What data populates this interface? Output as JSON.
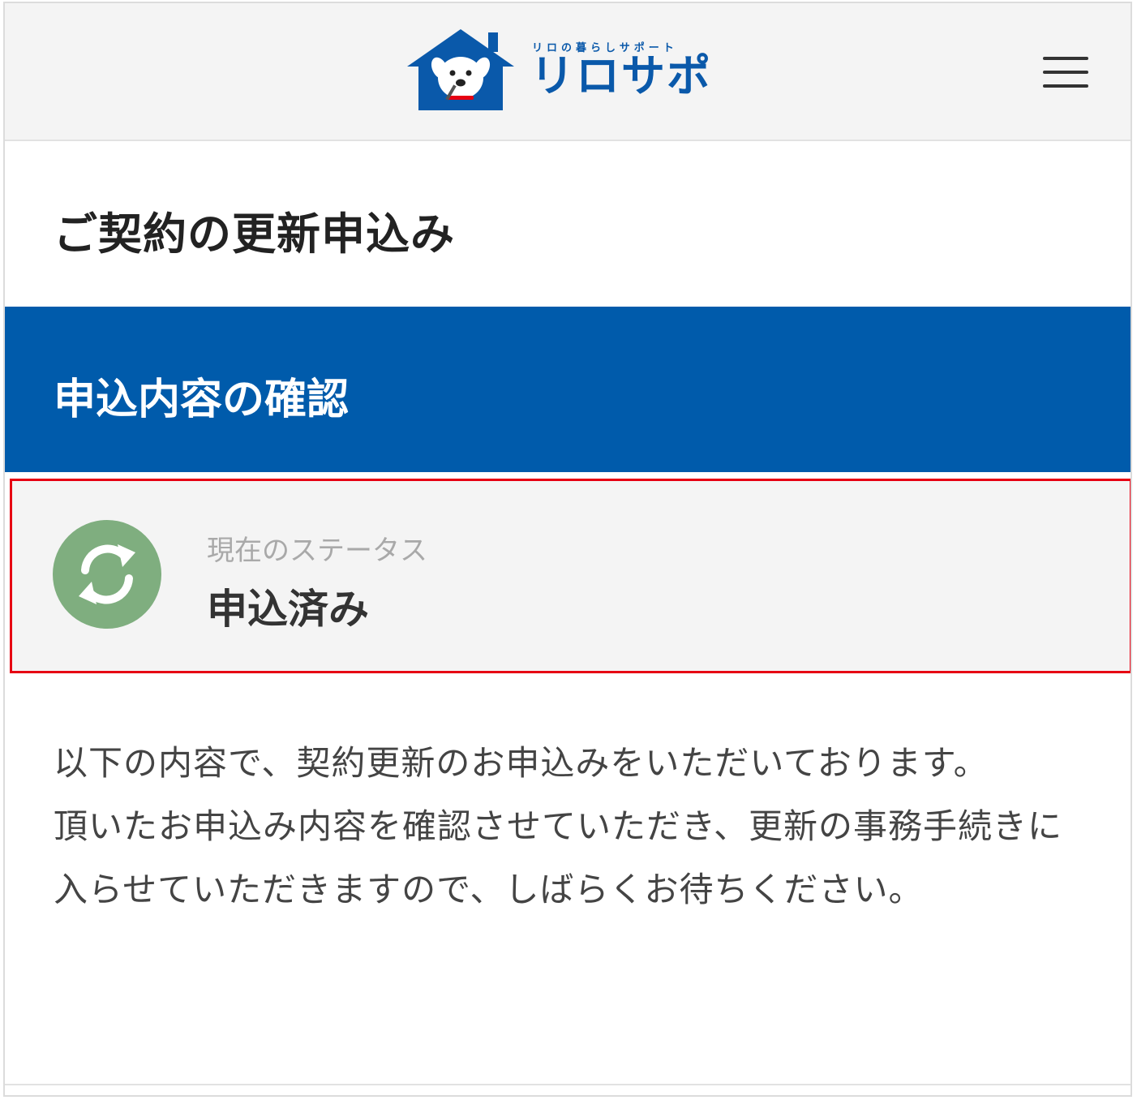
{
  "header": {
    "logo_tagline": "リロの暮らしサポート",
    "logo_text": "リロサポ",
    "logo_icon": "house-dog-logo",
    "menu_icon": "hamburger-menu-icon"
  },
  "page": {
    "title": "ご契約の更新申込み"
  },
  "section": {
    "title": "申込内容の確認"
  },
  "status": {
    "icon": "refresh-icon",
    "label": "現在のステータス",
    "value": "申込済み"
  },
  "message": {
    "paragraph1": "以下の内容で、契約更新のお申込みをいただいております。",
    "paragraph2": "頂いたお申込み内容を確認させていただき、更新の事務手続きに入らせていただきますので、しばらくお待ちください。"
  },
  "colors": {
    "brand_blue": "#005bab",
    "status_green": "#7fae7f",
    "highlight_red": "#e60012"
  }
}
